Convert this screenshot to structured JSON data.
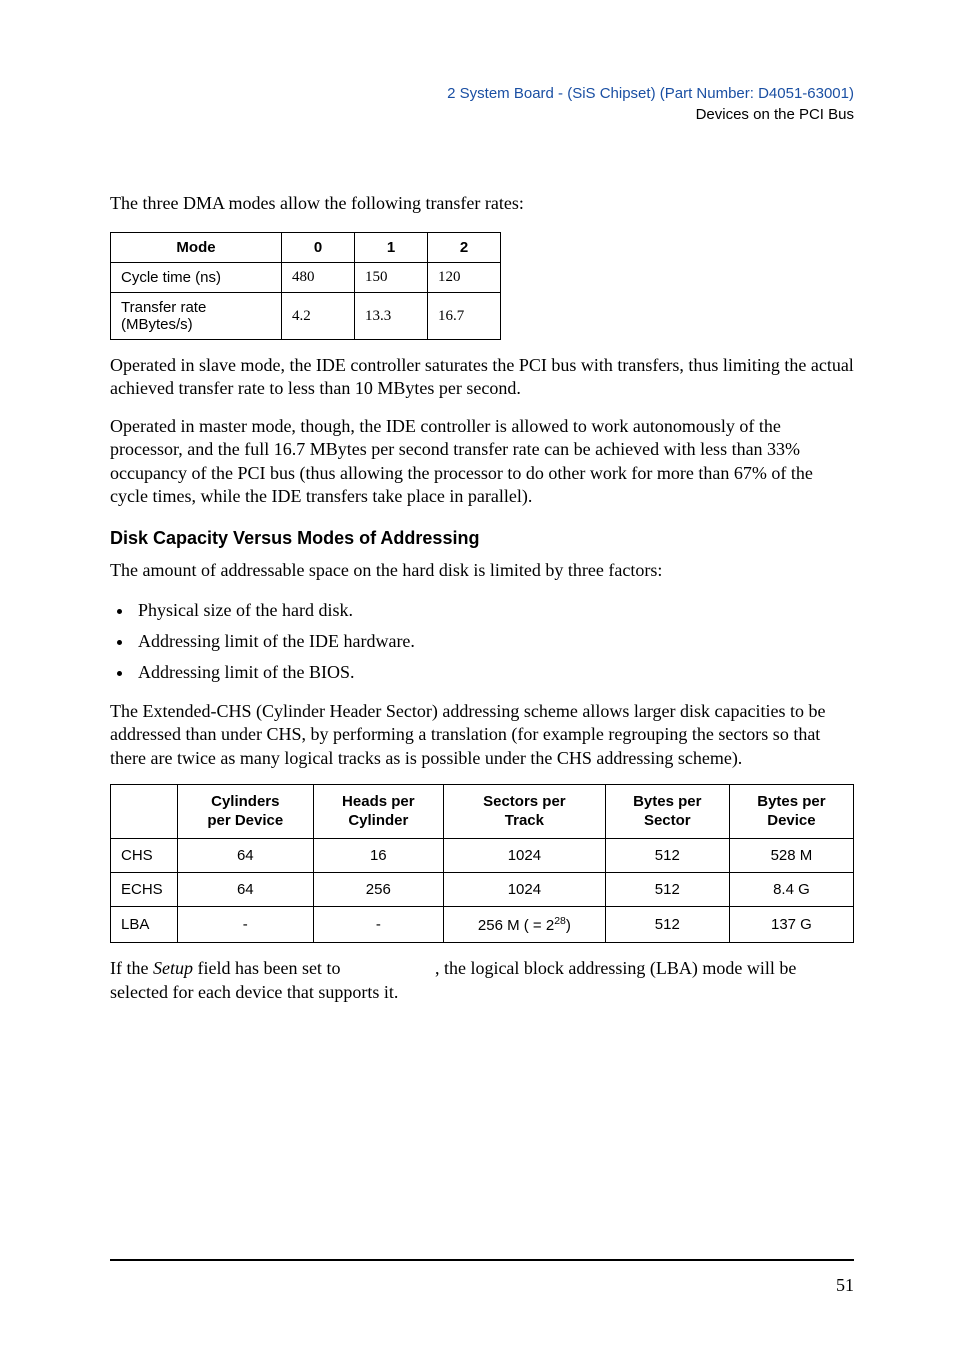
{
  "header": {
    "chapter": "2  System Board - (SiS Chipset) (Part Number: D4051-63001)",
    "section": "Devices on the PCI Bus"
  },
  "intro": "The three DMA modes allow the following transfer rates:",
  "dma_table": {
    "headers": [
      "Mode",
      "0",
      "1",
      "2"
    ],
    "rows": [
      {
        "label": "Cycle time (ns)",
        "v0": "480",
        "v1": "150",
        "v2": "120"
      },
      {
        "label": "Transfer rate (MBytes/s)",
        "v0": "4.2",
        "v1": "13.3",
        "v2": "16.7"
      }
    ]
  },
  "p1": "Operated in slave mode, the IDE controller saturates the PCI bus with transfers, thus limiting the actual achieved transfer rate to less than 10 MBytes per second.",
  "p2": "Operated in master mode, though, the IDE controller is allowed to work autonomously of the processor, and the full 16.7 MBytes per second transfer rate can be achieved with less than 33% occupancy of the PCI bus (thus allowing the processor to do other work for more than 67% of the cycle times, while the IDE transfers take place in parallel).",
  "section_title": "Disk Capacity Versus Modes of Addressing",
  "p3": "The amount of addressable space on the hard disk is limited by three factors:",
  "bullets": [
    "Physical size of the hard disk.",
    "Addressing limit of the IDE hardware.",
    "Addressing limit of the BIOS."
  ],
  "p4": "The Extended-CHS (Cylinder Header Sector) addressing scheme allows larger disk capacities to be addressed than under CHS, by performing a translation (for example regrouping the sectors so that there are twice as many logical tracks as is possible under the CHS addressing scheme).",
  "addr_table": {
    "headers": [
      "",
      "Cylinders per Device",
      "Heads per Cylinder",
      "Sectors per Track",
      "Bytes per Sector",
      "Bytes per Device"
    ],
    "rows": [
      {
        "label": "CHS",
        "c1": "64",
        "c2": "16",
        "c3": "1024",
        "c4": "512",
        "c5": "528 M"
      },
      {
        "label": "ECHS",
        "c1": "64",
        "c2": "256",
        "c3": "1024",
        "c4": "512",
        "c5": "8.4 G"
      },
      {
        "label": "LBA",
        "c1": "-",
        "c2": "-",
        "c3": "256 M ( = 2^28)",
        "c4": "512",
        "c5": "137 G"
      }
    ]
  },
  "closing": {
    "pre": "If the ",
    "italic": "Setup",
    "mid": " field has been set to ",
    "gap": " ",
    "post": ", the logical block addressing (LBA) mode will be selected for each device that supports it."
  },
  "page_number": "51"
}
